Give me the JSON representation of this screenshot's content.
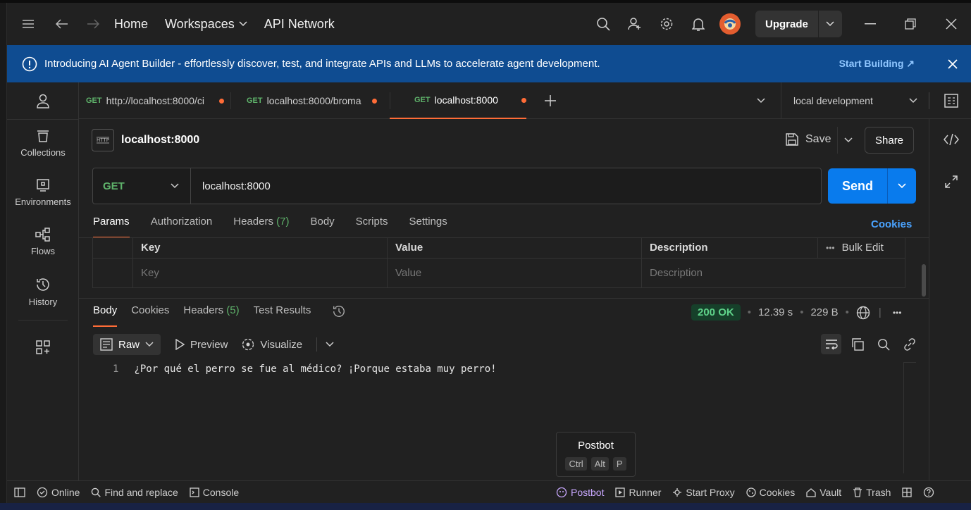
{
  "topnav": {
    "home": "Home",
    "workspaces": "Workspaces",
    "api_network": "API Network",
    "upgrade": "Upgrade"
  },
  "banner": {
    "message": "Introducing AI Agent Builder - effortlessly discover, test, and integrate APIs and LLMs to accelerate agent development.",
    "cta": "Start Building ↗"
  },
  "sidebar": {
    "items": [
      {
        "label": "Collections"
      },
      {
        "label": "Environments"
      },
      {
        "label": "Flows"
      },
      {
        "label": "History"
      }
    ]
  },
  "tabs": [
    {
      "method": "GET",
      "label": "http://localhost:8000/ci"
    },
    {
      "method": "GET",
      "label": "localhost:8000/broma"
    },
    {
      "method": "GET",
      "label": "localhost:8000"
    }
  ],
  "environment": "local development",
  "request": {
    "title": "localhost:8000",
    "save": "Save",
    "share": "Share",
    "method": "GET",
    "url": "localhost:8000",
    "send": "Send"
  },
  "req_tabs": {
    "params": "Params",
    "authorization": "Authorization",
    "headers": "Headers",
    "headers_count": "(7)",
    "body": "Body",
    "scripts": "Scripts",
    "settings": "Settings",
    "cookies": "Cookies"
  },
  "params_table": {
    "headers": {
      "key": "Key",
      "value": "Value",
      "description": "Description",
      "bulk_edit": "Bulk Edit"
    },
    "placeholders": {
      "key": "Key",
      "value": "Value",
      "description": "Description"
    }
  },
  "response": {
    "tabs": {
      "body": "Body",
      "cookies": "Cookies",
      "headers": "Headers",
      "headers_count": "(5)",
      "test_results": "Test Results"
    },
    "status": "200 OK",
    "time": "12.39 s",
    "size": "229 B",
    "format": "Raw",
    "preview": "Preview",
    "visualize": "Visualize",
    "line_number": "1",
    "body_text": "¿Por qué el perro se fue al médico? ¡Porque estaba muy perro!"
  },
  "postbot_popup": {
    "title": "Postbot",
    "keys": [
      "Ctrl",
      "Alt",
      "P"
    ]
  },
  "footer": {
    "online": "Online",
    "find_replace": "Find and replace",
    "console": "Console",
    "postbot": "Postbot",
    "runner": "Runner",
    "start_proxy": "Start Proxy",
    "cookies": "Cookies",
    "vault": "Vault",
    "trash": "Trash"
  },
  "colors": {
    "accent": "#ff6c37",
    "send": "#097bed",
    "banner": "#0f4c91",
    "get": "#5fb36b"
  }
}
